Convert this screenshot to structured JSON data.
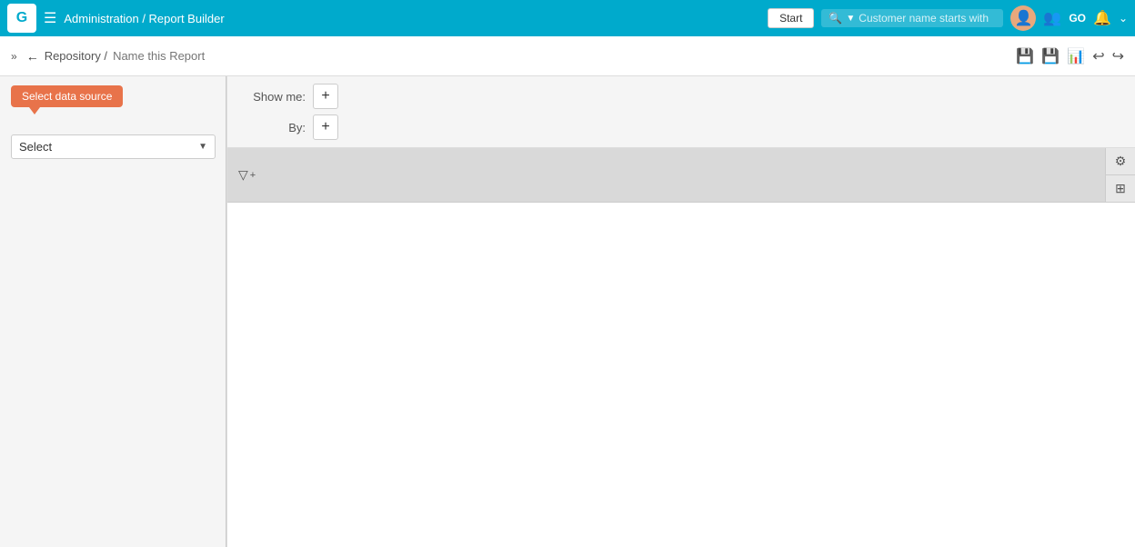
{
  "topBar": {
    "logo": "G",
    "breadcrumb": "Administration / Report Builder",
    "startButton": "Start",
    "search": {
      "placeholder": "Customer name starts with",
      "searchIcon": "🔍"
    },
    "icons": {
      "people": "👥",
      "go": "GO",
      "bell": "🔔",
      "chevron": "⌄"
    }
  },
  "subBar": {
    "collapseBtn": "»",
    "backIcon": "←",
    "breadcrumb": "Repository /",
    "reportNamePlaceholder": "Name this Report",
    "icons": {
      "save1": "💾",
      "save2": "💾",
      "chart": "📊",
      "undo": "↩",
      "redo": "↪"
    }
  },
  "leftPanel": {
    "tooltip": "Select data source",
    "selectLabel": "Select"
  },
  "controlsBar": {
    "showMeLabel": "Show me:",
    "byLabel": "By:",
    "addBtnLabel": "+"
  },
  "filterArea": {
    "filterIcon": "▼",
    "addLabel": "+",
    "sideIcons": {
      "gear": "⚙",
      "table": "⊞"
    }
  }
}
